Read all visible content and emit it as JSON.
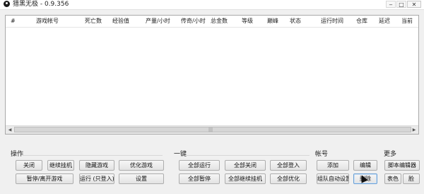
{
  "window": {
    "title": "猎黑无极 - 0.9.356",
    "controls": {
      "minimize": "‒",
      "maximize": "□",
      "close": "✕"
    }
  },
  "list": {
    "columns": [
      "#",
      "游戏帐号",
      "死亡数",
      "经验值",
      "产量/小时",
      "传奇/小时",
      "总金数",
      "等级",
      "巅峰",
      "状态",
      "运行时间",
      "仓库",
      "延迟",
      "当前"
    ],
    "rows": [],
    "scrollbar": {
      "left_arrow": "◀",
      "right_arrow": "▶",
      "grip": "|||"
    }
  },
  "groups": {
    "operation": {
      "label": "操作",
      "buttons": {
        "close": "关闭",
        "continue_hang": "继续挂机",
        "hide_game": "隐藏游戏",
        "optimize_game": "优化游戏",
        "pause_leave": "暂停/离开游戏",
        "run_login_only": "运行 (只登入)",
        "settings": "设置"
      }
    },
    "one_click": {
      "label": "一键",
      "buttons": {
        "run_all": "全部运行",
        "close_all": "全部关闭",
        "login_all": "全部登入",
        "pause_all": "全部暂停",
        "continue_all": "全部继续挂机",
        "optimize_all": "全部优化"
      }
    },
    "account": {
      "label": "帐号",
      "buttons": {
        "add": "添加",
        "edit": "编辑",
        "auto_team": "组队自动设置",
        "delete": "删除"
      }
    },
    "more": {
      "label": "更多",
      "buttons": {
        "script_editor": "脚本编辑器",
        "color": "表色",
        "other": "脸"
      }
    }
  }
}
